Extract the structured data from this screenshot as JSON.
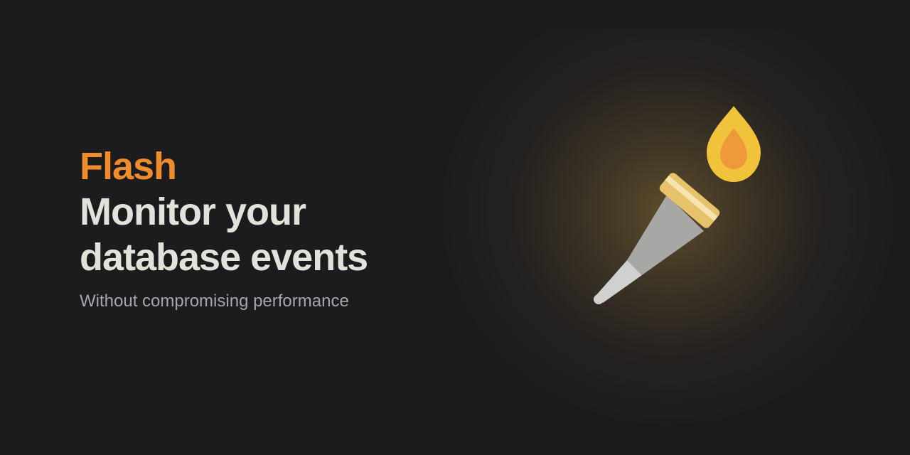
{
  "brand": "Flash",
  "headline": {
    "line1": "Monitor your",
    "line2": "database events"
  },
  "subtitle": "Without compromising performance",
  "colors": {
    "background": "#1c1c1f",
    "brand": "#ef8c2c",
    "headline": "#e4e1da",
    "subtitle": "#a6a5ab",
    "flame_outer": "#f0c33a",
    "flame_inner": "#ee9a3a",
    "torch_band": "#e6c36a",
    "torch_body": "#a7a7a5",
    "torch_tip": "#d0d0ce"
  },
  "illustration": {
    "icon": "torch-icon"
  }
}
